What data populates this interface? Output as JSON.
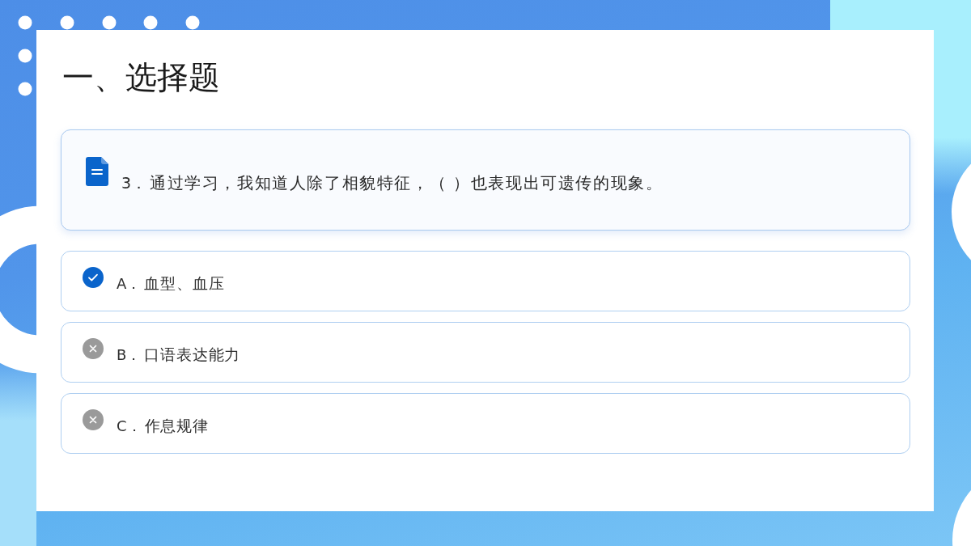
{
  "title": "一、选择题",
  "question": {
    "number": "3．",
    "text": "通过学习，我知道人除了相貌特征，（ ）也表现出可遗传的现象。"
  },
  "options": [
    {
      "letter": "A．",
      "text": "血型、血压",
      "correct": true
    },
    {
      "letter": "B．",
      "text": "口语表达能力",
      "correct": false
    },
    {
      "letter": "C．",
      "text": "作息规律",
      "correct": false
    }
  ]
}
